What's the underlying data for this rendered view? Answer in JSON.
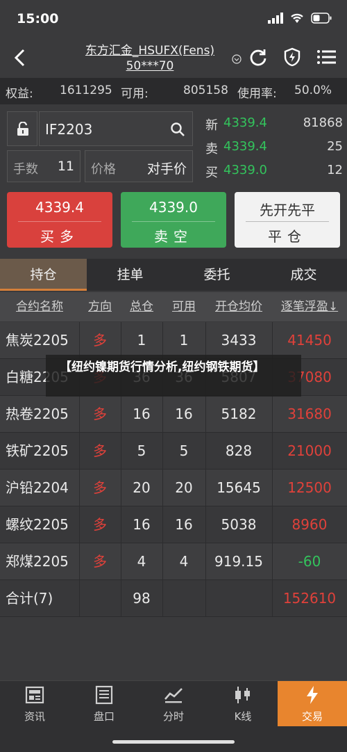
{
  "status_bar": {
    "time": "15:00"
  },
  "nav": {
    "title_line1": "东方汇金_HSUFX(Fens)",
    "title_line2": "50***70"
  },
  "account": {
    "equity_label": "权益:",
    "equity_value": "1611295",
    "available_label": "可用:",
    "available_value": "805158",
    "usage_label": "使用率:",
    "usage_value": "50.0%"
  },
  "order": {
    "symbol": "IF2203",
    "qty_label": "手数",
    "qty_value": "11",
    "price_label": "价格",
    "price_value": "对手价"
  },
  "quotes": [
    {
      "label": "新",
      "price": "4339.4",
      "volume": "81868"
    },
    {
      "label": "卖",
      "price": "4339.4",
      "volume": "25"
    },
    {
      "label": "买",
      "price": "4339.0",
      "volume": "12"
    }
  ],
  "buttons": {
    "buy_price": "4339.4",
    "buy_label": "买多",
    "sell_price": "4339.0",
    "sell_label": "卖空",
    "close_top": "先开先平",
    "close_label": "平仓"
  },
  "tabs": [
    "持仓",
    "挂单",
    "委托",
    "成交"
  ],
  "table": {
    "headers": [
      "合约名称",
      "方向",
      "总仓",
      "可用",
      "开仓均价",
      "逐笔浮盈↓"
    ],
    "rows": [
      {
        "name": "焦炭2205",
        "dir": "多",
        "total": "1",
        "avail": "1",
        "avg": "3433",
        "pnl": "41450"
      },
      {
        "name": "白糖2205",
        "dir": "多",
        "total": "36",
        "avail": "36",
        "avg": "5807",
        "pnl": "37080"
      },
      {
        "name": "热卷2205",
        "dir": "多",
        "total": "16",
        "avail": "16",
        "avg": "5182",
        "pnl": "31680"
      },
      {
        "name": "铁矿2205",
        "dir": "多",
        "total": "5",
        "avail": "5",
        "avg": "828",
        "pnl": "21000"
      },
      {
        "name": "沪铅2204",
        "dir": "多",
        "total": "20",
        "avail": "20",
        "avg": "15645",
        "pnl": "12500"
      },
      {
        "name": "螺纹2205",
        "dir": "多",
        "total": "16",
        "avail": "16",
        "avg": "5038",
        "pnl": "8960"
      },
      {
        "name": "郑煤2205",
        "dir": "多",
        "total": "4",
        "avail": "4",
        "avg": "919.15",
        "pnl": "-60"
      }
    ],
    "total_row": {
      "name": "合计(7)",
      "total": "98",
      "pnl": "152610"
    }
  },
  "overlay": {
    "text": "【纽约镍期货行情分析,纽约钢铁期货】"
  },
  "bottom_nav": [
    "资讯",
    "盘口",
    "分时",
    "K线",
    "交易"
  ],
  "colors": {
    "up": "#e0413a",
    "down": "#33c35c",
    "accent": "#e8852e"
  }
}
